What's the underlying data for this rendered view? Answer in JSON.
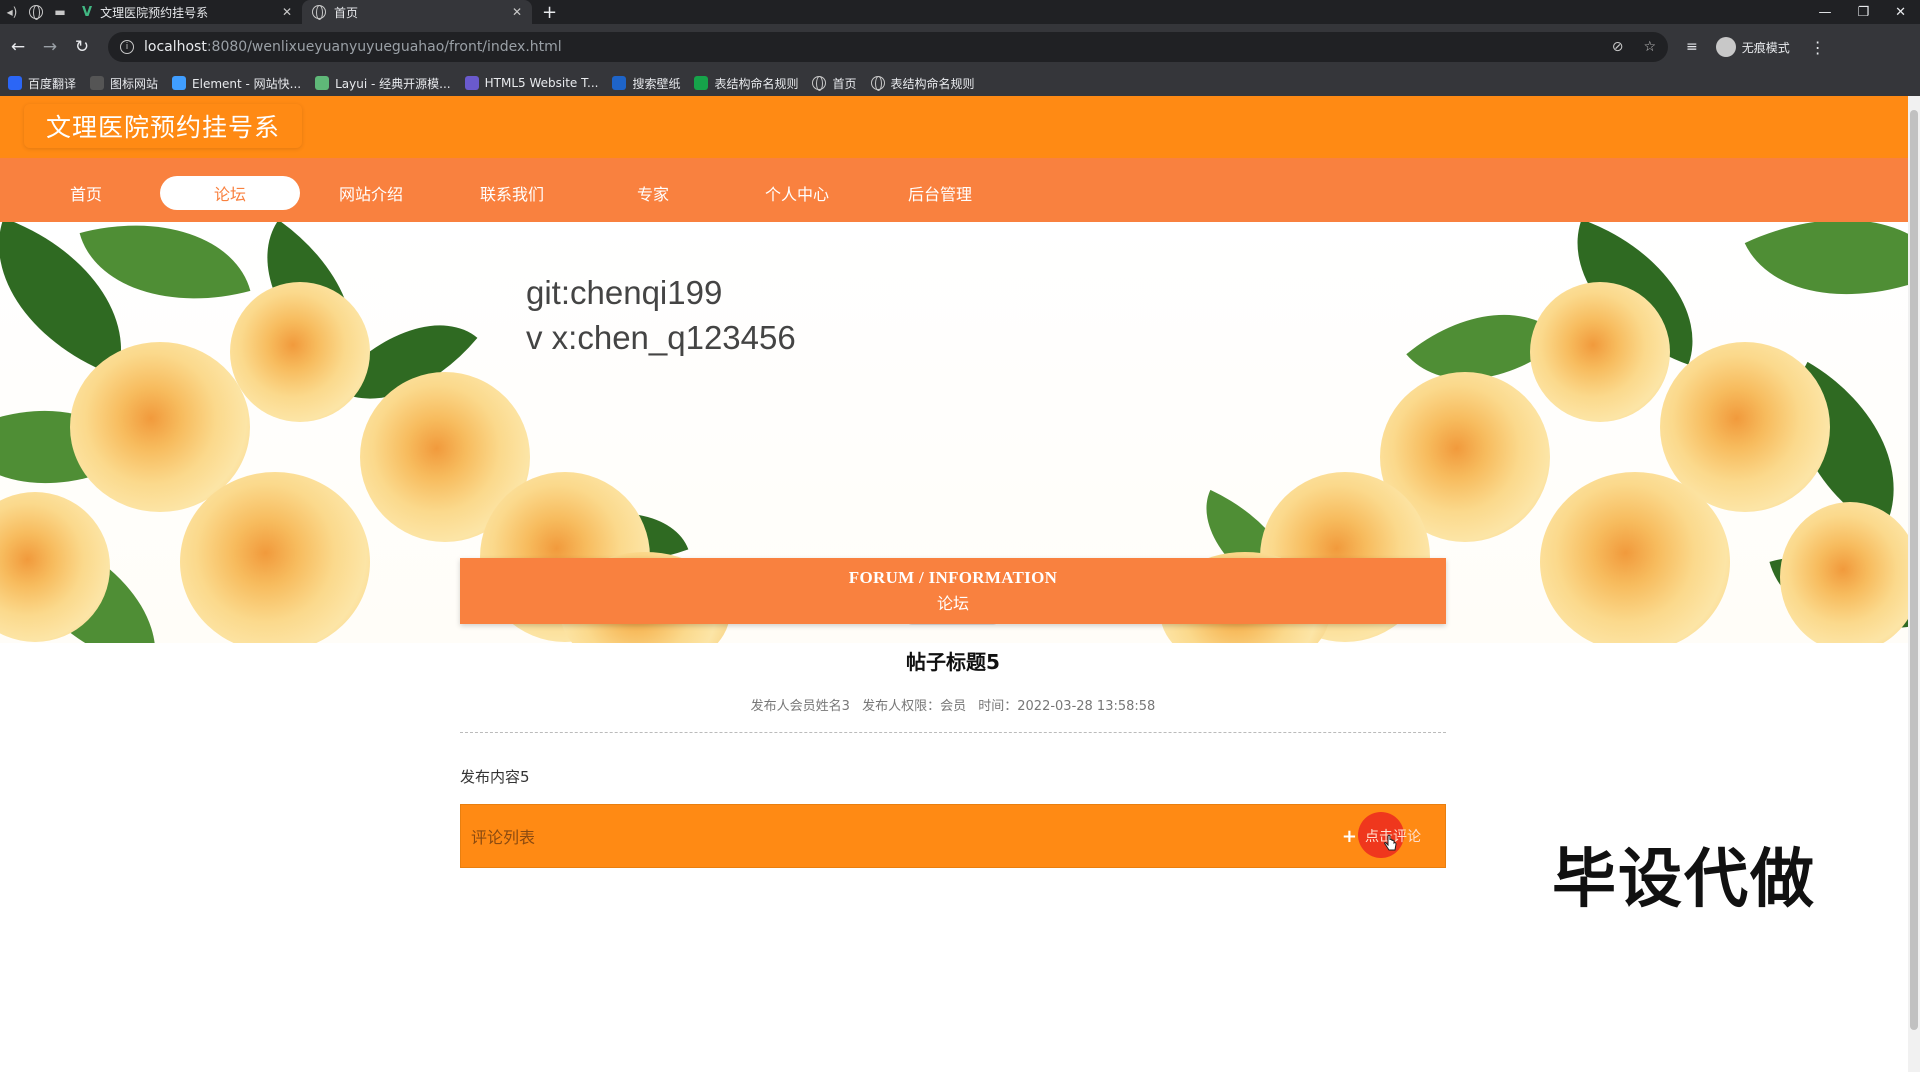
{
  "browser": {
    "tabs": [
      {
        "title": "文理医院预约挂号系",
        "active": false
      },
      {
        "title": "首页",
        "active": true
      }
    ],
    "new_tab_label": "+",
    "url_host": "localhost",
    "url_rest": ":8080/wenlixueyuanyuyueguahao/front/index.html",
    "profile_label": "无痕模式",
    "bookmarks": [
      {
        "label": "百度翻译",
        "color": "#2b66f6"
      },
      {
        "label": "图标网站",
        "color": "#333333"
      },
      {
        "label": "Element - 网站快...",
        "color": "#409eff"
      },
      {
        "label": "Layui - 经典开源模...",
        "color": "#5fb878"
      },
      {
        "label": "HTML5 Website T...",
        "color": "#6a5acd"
      },
      {
        "label": "搜索壁纸",
        "color": "#1e64c8"
      },
      {
        "label": "表结构命名规则",
        "color": "#16a34a"
      },
      {
        "label": "首页",
        "color": "#9aa0a6"
      },
      {
        "label": "表结构命名规则",
        "color": "#9aa0a6"
      }
    ]
  },
  "site": {
    "title": "文理医院预约挂号系",
    "nav": [
      {
        "label": "首页",
        "active": false
      },
      {
        "label": "论坛",
        "active": true
      },
      {
        "label": "网站介绍",
        "active": false
      },
      {
        "label": "联系我们",
        "active": false
      },
      {
        "label": "专家",
        "active": false
      },
      {
        "label": "个人中心",
        "active": false
      },
      {
        "label": "后台管理",
        "active": false
      }
    ],
    "accent_color": "#f9813f",
    "header_color": "#ff8a14"
  },
  "banner": {
    "line1": "git:chenqi199",
    "line2": "v x:chen_q123456",
    "slides_total": 3,
    "active_slide": 1
  },
  "forum": {
    "heading_en": "FORUM / INFORMATION",
    "heading_cn": "论坛"
  },
  "post": {
    "title": "帖子标题5",
    "author": "发布人会员姓名3",
    "role": "发布人权限：会员",
    "time": "时间：2022-03-28 13:58:58",
    "content": "发布内容5"
  },
  "comments": {
    "label": "评论列表",
    "add_label": "点击评论"
  },
  "watermark": "毕设代做"
}
